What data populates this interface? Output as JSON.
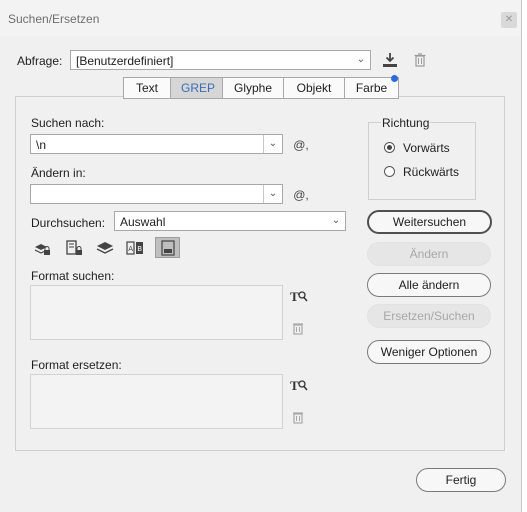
{
  "window": {
    "title": "Suchen/Ersetzen"
  },
  "query": {
    "label": "Abfrage:",
    "value": "[Benutzerdefiniert]"
  },
  "tabs": [
    {
      "label": "Text",
      "active": false
    },
    {
      "label": "GREP",
      "active": true
    },
    {
      "label": "Glyphe",
      "active": false
    },
    {
      "label": "Objekt",
      "active": false
    },
    {
      "label": "Farbe",
      "active": false
    }
  ],
  "search": {
    "label": "Suchen nach:",
    "value": "\\n"
  },
  "replace": {
    "label": "Ändern in:",
    "value": ""
  },
  "scope": {
    "label": "Durchsuchen:",
    "value": "Auswahl"
  },
  "special_char_glyph": "@,",
  "direction": {
    "label": "Richtung",
    "options": [
      {
        "label": "Vorwärts",
        "checked": true
      },
      {
        "label": "Rückwärts",
        "checked": false
      }
    ]
  },
  "format_search": {
    "label": "Format suchen:"
  },
  "format_replace": {
    "label": "Format ersetzen:"
  },
  "buttons": {
    "find_next": "Weitersuchen",
    "change": "Ändern",
    "change_all": "Alle ändern",
    "change_find": "Ersetzen/Suchen",
    "fewer_options": "Weniger Optionen",
    "done": "Fertig"
  },
  "colors": {
    "accent": "#3b6db3",
    "notification": "#2a6ce0"
  }
}
